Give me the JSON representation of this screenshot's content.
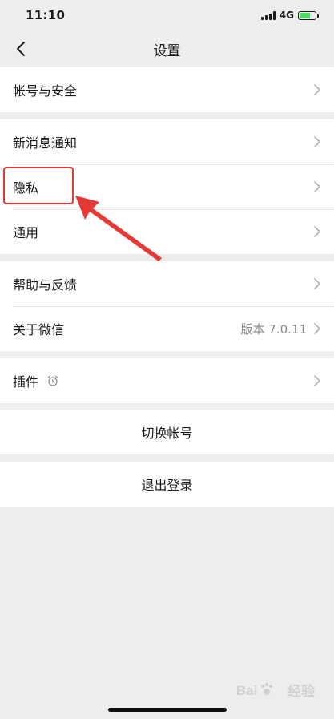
{
  "status_bar": {
    "time": "11:10",
    "network": "4G"
  },
  "nav": {
    "title": "设置",
    "back_icon": "chevron-left-icon"
  },
  "groups": [
    {
      "items": [
        {
          "label": "帐号与安全"
        }
      ]
    },
    {
      "items": [
        {
          "label": "新消息通知"
        },
        {
          "label": "隐私"
        },
        {
          "label": "通用"
        }
      ]
    },
    {
      "items": [
        {
          "label": "帮助与反馈"
        },
        {
          "label": "关于微信",
          "value": "版本 7.0.11"
        }
      ]
    },
    {
      "items": [
        {
          "label": "插件",
          "icon": "alarm-clock-icon"
        }
      ]
    }
  ],
  "actions": {
    "switch_account": "切换帐号",
    "logout": "退出登录"
  },
  "colors": {
    "background": "#ededed",
    "card": "#ffffff",
    "highlight": "#e53935",
    "battery": "#4cd964"
  },
  "watermark": {
    "text": "经验"
  }
}
